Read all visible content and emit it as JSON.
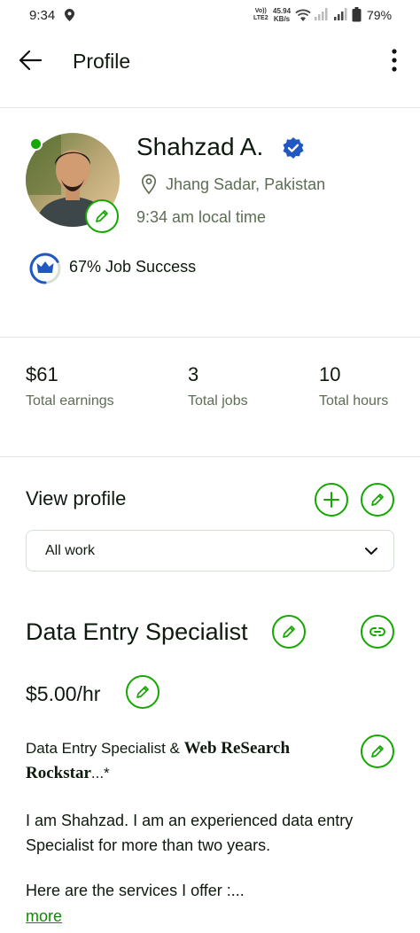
{
  "status_bar": {
    "time": "9:34",
    "volte_top": "Vo))",
    "volte_bottom": "LTE2",
    "speed_value": "45.94",
    "speed_unit": "KB/s",
    "battery": "79%"
  },
  "app_bar": {
    "title": "Profile",
    "back_icon": "arrow-left-icon",
    "menu_icon": "more-vertical-icon"
  },
  "profile": {
    "name": "Shahzad A.",
    "location": "Jhang Sadar, Pakistan",
    "local_time": "9:34 am local time",
    "job_success": "67% Job Success",
    "job_success_value": 67,
    "online": true
  },
  "stats": [
    {
      "value": "$61",
      "label": "Total earnings"
    },
    {
      "value": "3",
      "label": "Total jobs"
    },
    {
      "value": "10",
      "label": "Total hours"
    }
  ],
  "view_profile": {
    "title": "View profile",
    "filter_value": "All work"
  },
  "specialized": {
    "title": "Data Entry Specialist",
    "rate": "$5.00/hr",
    "overview_title_plain": "Data Entry Specialist & ",
    "overview_title_fancy": "Web ReSearch Rockstar",
    "overview_title_suffix": "...*",
    "overview_body": "I am Shahzad. I am an experienced data entry Specialist for more than two years.",
    "overview_services": "Here are the services I offer :...",
    "more_link": "more"
  },
  "colors": {
    "accent": "#14a800",
    "verified": "#1f57c3",
    "muted_text": "#5e6d55"
  }
}
